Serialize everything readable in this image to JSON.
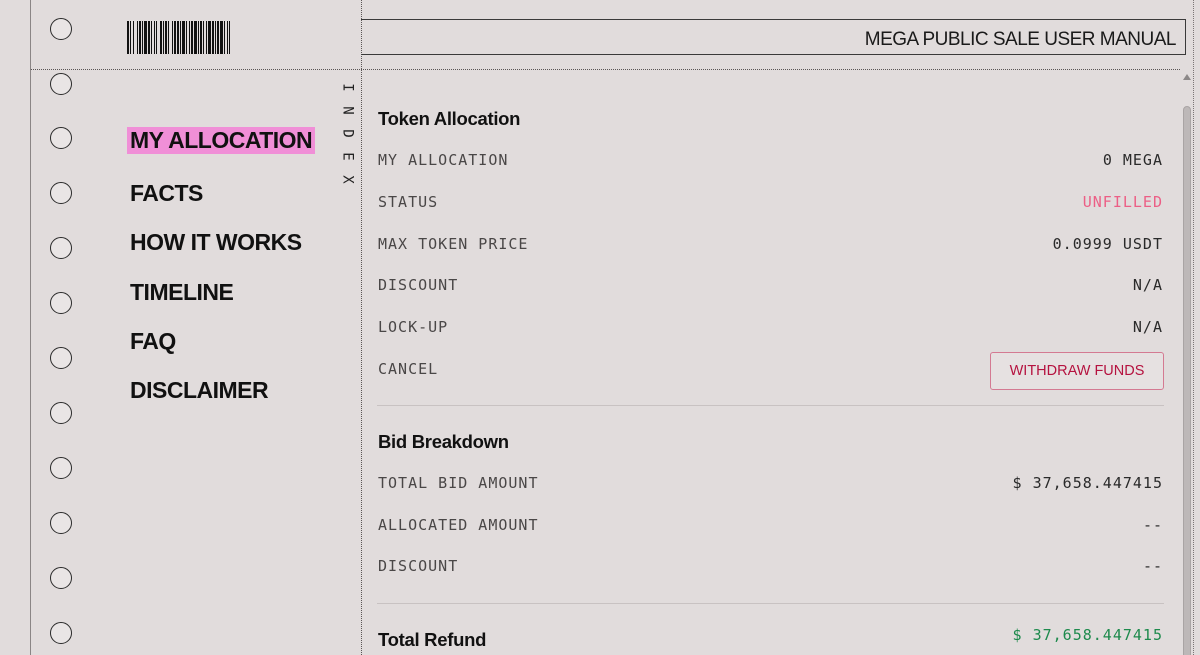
{
  "header": {
    "title": "MEGA PUBLIC SALE USER MANUAL"
  },
  "sidebar": {
    "index_label": "INDEX",
    "items": [
      {
        "label": "MY ALLOCATION",
        "active": true
      },
      {
        "label": "FACTS",
        "active": false
      },
      {
        "label": "HOW IT WORKS",
        "active": false
      },
      {
        "label": "TIMELINE",
        "active": false
      },
      {
        "label": "FAQ",
        "active": false
      },
      {
        "label": "DISCLAIMER",
        "active": false
      }
    ]
  },
  "token_allocation": {
    "title": "Token Allocation",
    "rows": [
      {
        "label": "MY ALLOCATION",
        "value": "0 MEGA"
      },
      {
        "label": "STATUS",
        "value": "UNFILLED"
      },
      {
        "label": "MAX TOKEN PRICE",
        "value": "0.0999 USDT"
      },
      {
        "label": "DISCOUNT",
        "value": "N/A"
      },
      {
        "label": "LOCK-UP",
        "value": "N/A"
      },
      {
        "label": "CANCEL",
        "value": ""
      }
    ],
    "withdraw_label": "WITHDRAW FUNDS"
  },
  "bid_breakdown": {
    "title": "Bid Breakdown",
    "rows": [
      {
        "label": "TOTAL BID AMOUNT",
        "value": "$ 37,658.447415"
      },
      {
        "label": "ALLOCATED AMOUNT",
        "value": "--"
      },
      {
        "label": "DISCOUNT",
        "value": "--"
      }
    ]
  },
  "total_refund": {
    "title": "Total Refund",
    "value": "$ 37,658.447415"
  },
  "colors": {
    "background": "#e1dcdc",
    "active_highlight": "#f08fd7",
    "unfilled": "#ec5f86",
    "withdraw": "#b5123f",
    "refund_green": "#1d8a4c"
  }
}
